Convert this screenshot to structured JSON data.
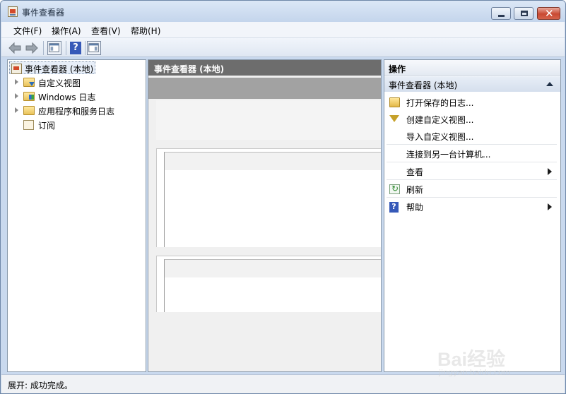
{
  "window": {
    "title": "事件查看器",
    "controls": {
      "minimize": "minimize",
      "maximize": "maximize",
      "close": "✕"
    }
  },
  "menu": [
    {
      "label": "文件(F)"
    },
    {
      "label": "操作(A)"
    },
    {
      "label": "查看(V)"
    },
    {
      "label": "帮助(H)"
    }
  ],
  "toolbar": {
    "icons": [
      "back-arrow-icon",
      "forward-arrow-icon",
      "show-hide-console-tree-icon",
      "help-icon",
      "show-hide-action-pane-icon"
    ],
    "help_glyph": "?"
  },
  "tree": {
    "root": "事件查看器 (本地)",
    "items": [
      {
        "label": "自定义视图",
        "expandable": true,
        "icon": "folder-view-icon"
      },
      {
        "label": "Windows 日志",
        "expandable": true,
        "icon": "folder-windows-icon"
      },
      {
        "label": "应用程序和服务日志",
        "expandable": true,
        "icon": "folder-icon"
      },
      {
        "label": "订阅",
        "expandable": false,
        "icon": "subscription-icon"
      }
    ]
  },
  "center": {
    "header": "事件查看器 (本地)"
  },
  "actions": {
    "header": "操作",
    "section": "事件查看器 (本地)",
    "items": [
      {
        "label": "打开保存的日志...",
        "icon": "open-folder-icon",
        "submenu": false
      },
      {
        "label": "创建自定义视图...",
        "icon": "filter-icon",
        "submenu": false
      },
      {
        "label": "导入自定义视图...",
        "icon": "",
        "submenu": false
      },
      {
        "label": "连接到另一台计算机...",
        "icon": "",
        "submenu": false
      },
      {
        "label": "查看",
        "icon": "",
        "submenu": true
      },
      {
        "label": "刷新",
        "icon": "refresh-icon",
        "submenu": false
      },
      {
        "label": "帮助",
        "icon": "help-icon",
        "submenu": true
      }
    ],
    "help_glyph": "?"
  },
  "status": {
    "text": "展开: 成功完成。"
  },
  "watermark": {
    "main": "Bai经验",
    "url": "jingyan.baidu.com"
  },
  "colors": {
    "frame": "#c9d9ee",
    "center_header": "#6d6d6d",
    "close_button": "#c94a33"
  }
}
